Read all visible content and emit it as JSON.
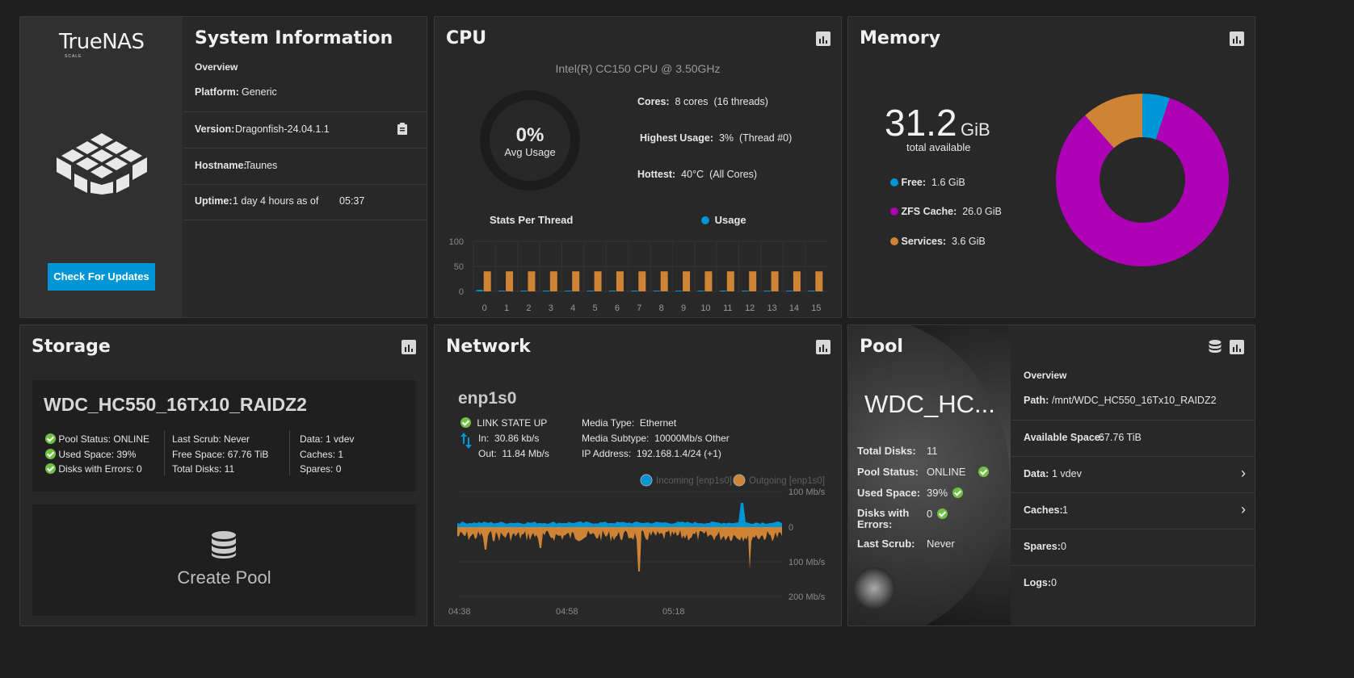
{
  "system": {
    "logo_text": "TrueNAS",
    "logo_sub": "SCALE",
    "title": "System Information",
    "overview": "Overview",
    "platform_label": "Platform:",
    "platform": "Generic",
    "version_label": "Version:",
    "version": "Dragonfish-24.04.1.1",
    "hostname_label": "Hostname:",
    "hostname": "Taunes",
    "uptime_label": "Uptime:",
    "uptime": "1 day 4 hours as of",
    "uptime_time": "05:37",
    "update_button": "Check For Updates"
  },
  "cpu": {
    "title": "CPU",
    "model": "Intel(R) CC150 CPU @ 3.50GHz",
    "avg_value": "0%",
    "avg_label": "Avg Usage",
    "cores_label": "Cores:",
    "cores": "8 cores",
    "threads": "(16 threads)",
    "highest_label": "Highest Usage:",
    "highest": "3%",
    "highest_thread": "(Thread #0)",
    "hottest_label": "Hottest:",
    "hottest": "40°C",
    "hottest_scope": "(All Cores)",
    "stats_title": "Stats Per Thread",
    "legend_usage": "Usage",
    "usage_color": "#0095d5",
    "temp_color": "#ce8335"
  },
  "chart_data": [
    {
      "type": "bar",
      "title": "Stats Per Thread",
      "categories": [
        "0",
        "1",
        "2",
        "3",
        "4",
        "5",
        "6",
        "7",
        "8",
        "9",
        "10",
        "11",
        "12",
        "13",
        "14",
        "15"
      ],
      "series": [
        {
          "name": "Usage",
          "values": [
            3,
            0,
            0,
            0,
            0,
            0,
            1,
            0,
            0,
            0,
            0,
            0,
            1,
            0,
            0,
            0
          ]
        },
        {
          "values": [
            40,
            40,
            40,
            40,
            40,
            40,
            40,
            40,
            40,
            40,
            40,
            40,
            40,
            40,
            40,
            40
          ]
        }
      ],
      "yticks": [
        "100",
        "50",
        "0"
      ],
      "ylim": [
        0,
        100
      ]
    },
    {
      "type": "pie",
      "labels": [
        "Free",
        "ZFS Cache",
        "Services"
      ],
      "values": [
        1.6,
        26.0,
        3.6
      ]
    },
    {
      "type": "area",
      "series": [
        {
          "name": "Incoming [enp1s0]"
        },
        {
          "name": "Outgoing [enp1s0]"
        }
      ],
      "xticks": [
        "04:38",
        "04:58",
        "05:18"
      ],
      "yticks": [
        "100 Mb/s",
        "0",
        "100 Mb/s",
        "200 Mb/s"
      ]
    }
  ],
  "memory": {
    "title": "Memory",
    "total_value": "31.2",
    "total_unit": "GiB",
    "total_label": "total available",
    "free_label": "Free:",
    "free": "1.6 GiB",
    "zfs_label": "ZFS Cache:",
    "zfs": "26.0 GiB",
    "services_label": "Services:",
    "services": "3.6 GiB",
    "colors": {
      "free": "#0095d5",
      "zfs": "#ae01b5",
      "services": "#ce8335"
    }
  },
  "storage": {
    "title": "Storage",
    "pool_name": "WDC_HC550_16Tx10_RAIDZ2",
    "pool_status": "Pool Status:  ONLINE",
    "used_space": "Used Space:  39%",
    "disks_errors": "Disks with Errors:  0",
    "last_scrub": "Last Scrub:  Never",
    "free_space": "Free Space:  67.76 TiB",
    "total_disks": "Total Disks:  11",
    "data": "Data:  1 vdev",
    "caches": "Caches:  1",
    "spares": "Spares:  0",
    "create_pool": "Create Pool"
  },
  "network": {
    "title": "Network",
    "interface": "enp1s0",
    "link_state": "LINK STATE UP",
    "in_label": "In:",
    "in_value": "30.86 kb/s",
    "out_label": "Out:",
    "out_value": "11.84 Mb/s",
    "media_type_label": "Media Type:",
    "media_type": "Ethernet",
    "media_subtype_label": "Media Subtype:",
    "media_subtype": "10000Mb/s Other",
    "ip_label": "IP Address:",
    "ip": "192.168.1.4/24 (+1)"
  },
  "pool": {
    "title": "Pool",
    "name_short": "WDC_HC...",
    "total_disks_label": "Total Disks:",
    "total_disks": "11",
    "status_label": "Pool Status:",
    "status": "ONLINE",
    "used_label": "Used Space:",
    "used": "39%",
    "errors_label": "Disks with Errors:",
    "errors": "0",
    "scrub_label": "Last Scrub:",
    "scrub": "Never",
    "overview": "Overview",
    "path_label": "Path:",
    "path": "/mnt/WDC_HC550_16Tx10_RAIDZ2",
    "avail_label": "Available Space:",
    "avail": "67.76 TiB",
    "data_label": "Data:",
    "data": "1 vdev",
    "caches_label": "Caches:",
    "caches": "1",
    "spares_label": "Spares:",
    "spares": "0",
    "logs_label": "Logs:",
    "logs": "0"
  }
}
